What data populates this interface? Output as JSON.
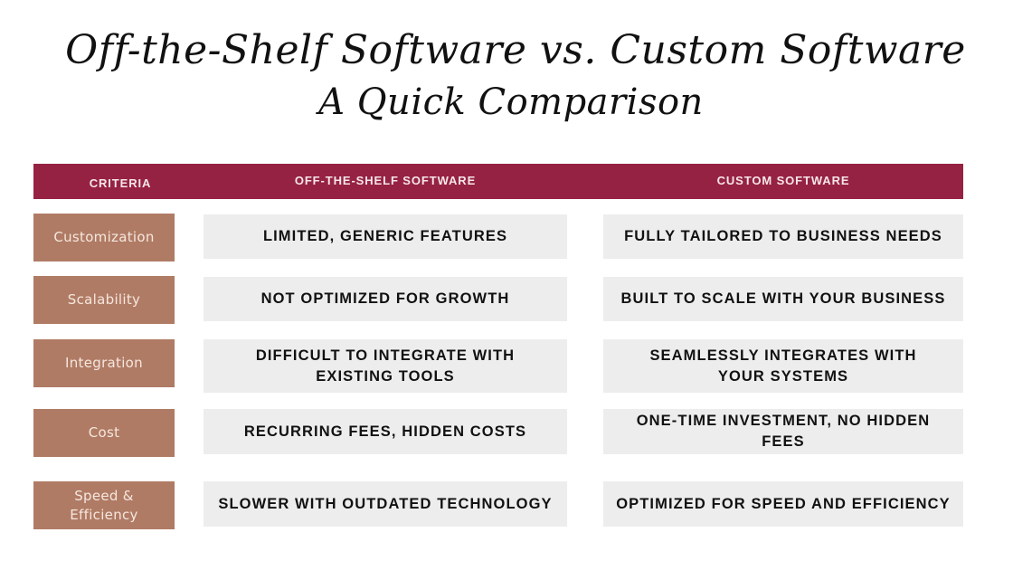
{
  "title": {
    "line1": "Off-the-Shelf Software vs. Custom Software",
    "line2": "A Quick Comparison"
  },
  "table": {
    "headers": {
      "criteria": "CRITERIA",
      "off_the_shelf": "OFF-THE-SHELF SOFTWARE",
      "custom": "CUSTOM SOFTWARE"
    },
    "rows": [
      {
        "criteria": "Customization",
        "off_the_shelf": "LIMITED, GENERIC FEATURES",
        "custom": "FULLY TAILORED TO BUSINESS NEEDS"
      },
      {
        "criteria": "Scalability",
        "off_the_shelf": "NOT OPTIMIZED FOR GROWTH",
        "custom": "BUILT TO SCALE WITH YOUR BUSINESS"
      },
      {
        "criteria": "Integration",
        "off_the_shelf": "DIFFICULT TO INTEGRATE WITH EXISTING TOOLS",
        "custom": "SEAMLESSLY INTEGRATES WITH YOUR SYSTEMS"
      },
      {
        "criteria": "Cost",
        "off_the_shelf": "RECURRING FEES, HIDDEN COSTS",
        "custom": "ONE-TIME INVESTMENT, NO HIDDEN FEES"
      },
      {
        "criteria": "Speed & Efficiency",
        "off_the_shelf": "SLOWER WITH OUTDATED TECHNOLOGY",
        "custom": "OPTIMIZED FOR SPEED AND EFFICIENCY"
      }
    ]
  },
  "colors": {
    "header_bg": "#962243",
    "criteria_bg": "#B07B65",
    "cell_bg": "#EDEDED"
  }
}
